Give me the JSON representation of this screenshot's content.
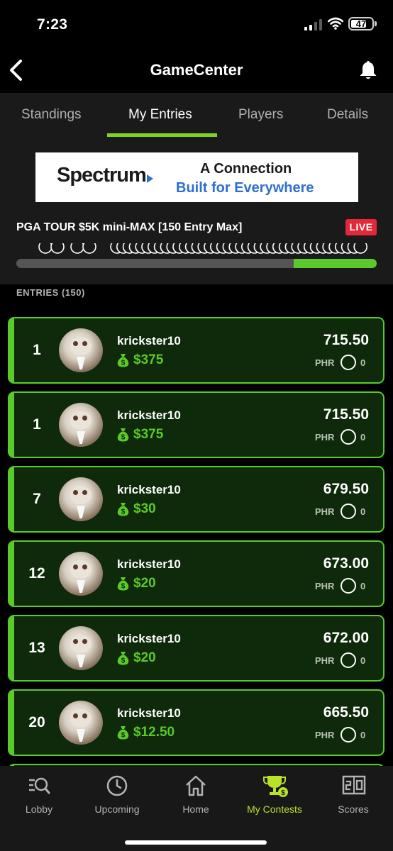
{
  "status_bar": {
    "time": "7:23",
    "battery": "47"
  },
  "header": {
    "title": "GameCenter",
    "back_icon": "chevron-left-icon",
    "bell_icon": "bell-icon"
  },
  "tabs": [
    {
      "label": "Standings",
      "active": false
    },
    {
      "label": "My Entries",
      "active": true
    },
    {
      "label": "Players",
      "active": false
    },
    {
      "label": "Details",
      "active": false
    }
  ],
  "ad": {
    "brand": "Spectrum",
    "line1": "A Connection",
    "line2": "Built for Everywhere"
  },
  "contest": {
    "title": "PGA TOUR $5K mini-MAX [150 Entry Max]",
    "status": "LIVE",
    "progress_fraction": 0.23
  },
  "entries_header": "ENTRIES (150)",
  "entries": [
    {
      "rank": "1",
      "user": "krickster10",
      "prize": "$375",
      "score": "715.50",
      "phr_label": "PHR",
      "phr": "0"
    },
    {
      "rank": "1",
      "user": "krickster10",
      "prize": "$375",
      "score": "715.50",
      "phr_label": "PHR",
      "phr": "0"
    },
    {
      "rank": "7",
      "user": "krickster10",
      "prize": "$30",
      "score": "679.50",
      "phr_label": "PHR",
      "phr": "0"
    },
    {
      "rank": "12",
      "user": "krickster10",
      "prize": "$20",
      "score": "673.00",
      "phr_label": "PHR",
      "phr": "0"
    },
    {
      "rank": "13",
      "user": "krickster10",
      "prize": "$20",
      "score": "672.00",
      "phr_label": "PHR",
      "phr": "0"
    },
    {
      "rank": "20",
      "user": "krickster10",
      "prize": "$12.50",
      "score": "665.50",
      "phr_label": "PHR",
      "phr": "0"
    }
  ],
  "bottom_nav": [
    {
      "label": "Lobby",
      "icon": "lobby-search-icon",
      "active": false
    },
    {
      "label": "Upcoming",
      "icon": "clock-icon",
      "active": false
    },
    {
      "label": "Home",
      "icon": "home-icon",
      "active": false
    },
    {
      "label": "My Contests",
      "icon": "trophy-icon",
      "active": true
    },
    {
      "label": "Scores",
      "icon": "scoreboard-icon",
      "active": false
    }
  ],
  "colors": {
    "accent_green": "#5ac92a",
    "tab_underline": "#7ed321",
    "live_red": "#e2283a",
    "nav_active": "#b9e22b",
    "card_bg": "#0e2a0a"
  }
}
